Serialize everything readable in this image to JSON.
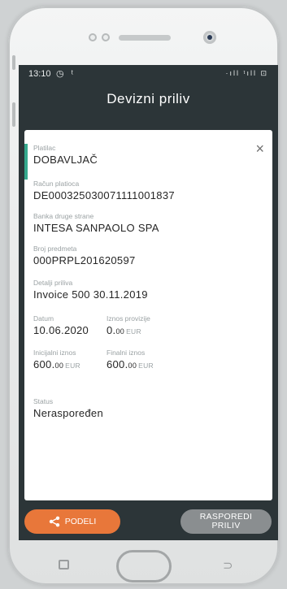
{
  "statusbar": {
    "time": "13:10",
    "icons_left": "◷ ᵗ",
    "icons_right": "·ıll ᵗıll ⊡"
  },
  "header": {
    "title": "Devizni priliv"
  },
  "details": {
    "platilac_label": "Platilac",
    "platilac_value": "DOBAVLJAČ",
    "racun_label": "Račun platioca",
    "racun_value": "DE00032503007111100183​7",
    "banka_label": "Banka druge strane",
    "banka_value": "INTESA SANPAOLO SPA",
    "broj_label": "Broj predmeta",
    "broj_value": "000PRPL201620597",
    "detalji_label": "Detalji priliva",
    "detalji_value": "Invoice  500 30.11.2019",
    "datum_label": "Datum",
    "datum_value": "10.06.2020",
    "provizija_label": "Iznos provizije",
    "provizija_amount": "0.",
    "provizija_dec": "00",
    "provizija_unit": "EUR",
    "inicijalni_label": "Inicijalni iznos",
    "inicijalni_amount": "600.",
    "inicijalni_dec": "00",
    "inicijalni_unit": "EUR",
    "finalni_label": "Finalni iznos",
    "finalni_amount": "600.",
    "finalni_dec": "00",
    "finalni_unit": "EUR",
    "status_label": "Status",
    "status_value": "Neraspoređen"
  },
  "actions": {
    "share_label": "PODELI",
    "assign_line1": "RASPOREDI",
    "assign_line2": "PRILIV"
  },
  "icons": {
    "close": "×",
    "back": "⊃"
  },
  "colors": {
    "screen_bg": "#2c3538",
    "accent_green": "#35a88d",
    "share_orange": "#e8773a",
    "assign_gray": "#8a8e90"
  }
}
